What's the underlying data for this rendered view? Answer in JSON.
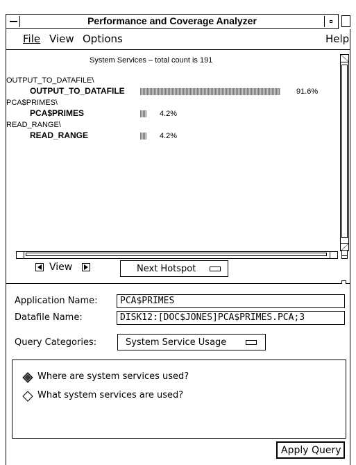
{
  "window": {
    "title": "Performance and Coverage Analyzer"
  },
  "menu": {
    "file": "File",
    "view": "View",
    "options": "Options",
    "help": "Help"
  },
  "report": {
    "heading": "System Services – total count is 191",
    "rows": [
      {
        "group": "OUTPUT_TO_DATAFILE\\",
        "name": "OUTPUT_TO_DATAFILE",
        "percent_label": "91.6%",
        "fraction": 0.916
      },
      {
        "group": "PCA$PRIMES\\",
        "name": "PCA$PRIMES",
        "percent_label": "4.2%",
        "fraction": 0.042
      },
      {
        "group": "READ_RANGE\\",
        "name": "READ_RANGE",
        "percent_label": "4.2%",
        "fraction": 0.042
      }
    ]
  },
  "nav": {
    "view_label": "View",
    "next_hotspot_label": "Next Hotspot"
  },
  "form": {
    "application_name_label": "Application Name:",
    "application_name_value": "PCA$PRIMES",
    "datafile_name_label": "Datafile Name:",
    "datafile_name_value": "DISK12:[DOC$JONES]PCA$PRIMES.PCA;3",
    "query_categories_label": "Query Categories:",
    "query_categories_value": "System Service Usage"
  },
  "queries": {
    "options": [
      {
        "label": "Where are system services used?",
        "selected": true
      },
      {
        "label": "What system services are used?",
        "selected": false
      }
    ]
  },
  "actions": {
    "apply_query_label": "Apply Query"
  }
}
